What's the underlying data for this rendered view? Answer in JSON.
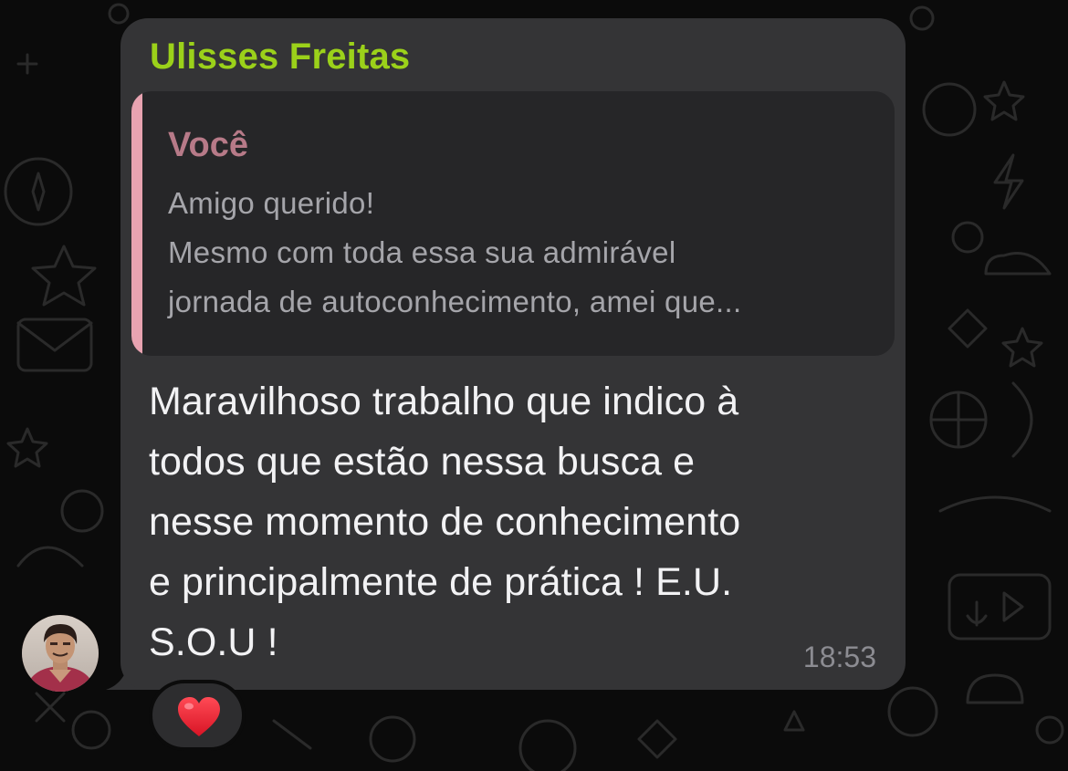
{
  "message": {
    "sender_name": "Ulisses Freitas",
    "quote": {
      "author": "Você",
      "lines": [
        "Amigo querido!",
        "Mesmo com toda essa sua admirável",
        "jornada de autoconhecimento, amei que..."
      ]
    },
    "body_lines": [
      "Maravilhoso trabalho que indico à",
      "todos que estão nessa busca e",
      "nesse momento de conhecimento",
      "e principalmente de prática !    E.U.",
      "S.O.U  !"
    ],
    "time": "18:53",
    "reaction": "heart-emoji"
  },
  "colors": {
    "background": "#0b0b0b",
    "bubble": "#343436",
    "sender_name": "#9bd11a",
    "quote_bar": "#e8a3b1",
    "quote_author": "#b77a88",
    "heart": "#e8202f"
  }
}
